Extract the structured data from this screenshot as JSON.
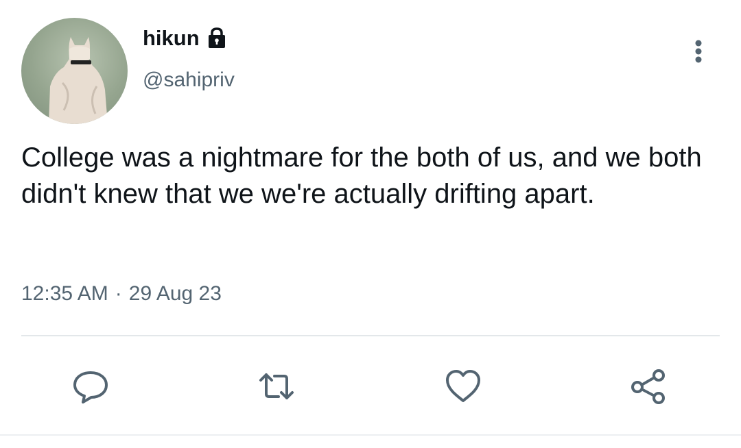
{
  "tweet": {
    "display_name": "hikun",
    "handle": "@sahipriv",
    "text": "College was a nightmare for the both of us, and we both didn't knew that we we're actually drifting apart.",
    "time": "12:35 AM",
    "separator": "·",
    "date": "29 Aug 23"
  },
  "icons": {
    "avatar": "avatar-photo",
    "lock": "lock-icon",
    "more": "more-vertical-icon",
    "reply": "reply-icon",
    "retweet": "retweet-icon",
    "like": "heart-icon",
    "share": "share-icon"
  },
  "colors": {
    "text_primary": "#0f1419",
    "text_secondary": "#536471",
    "icon": "#536471",
    "divider": "#e3e7ea"
  }
}
